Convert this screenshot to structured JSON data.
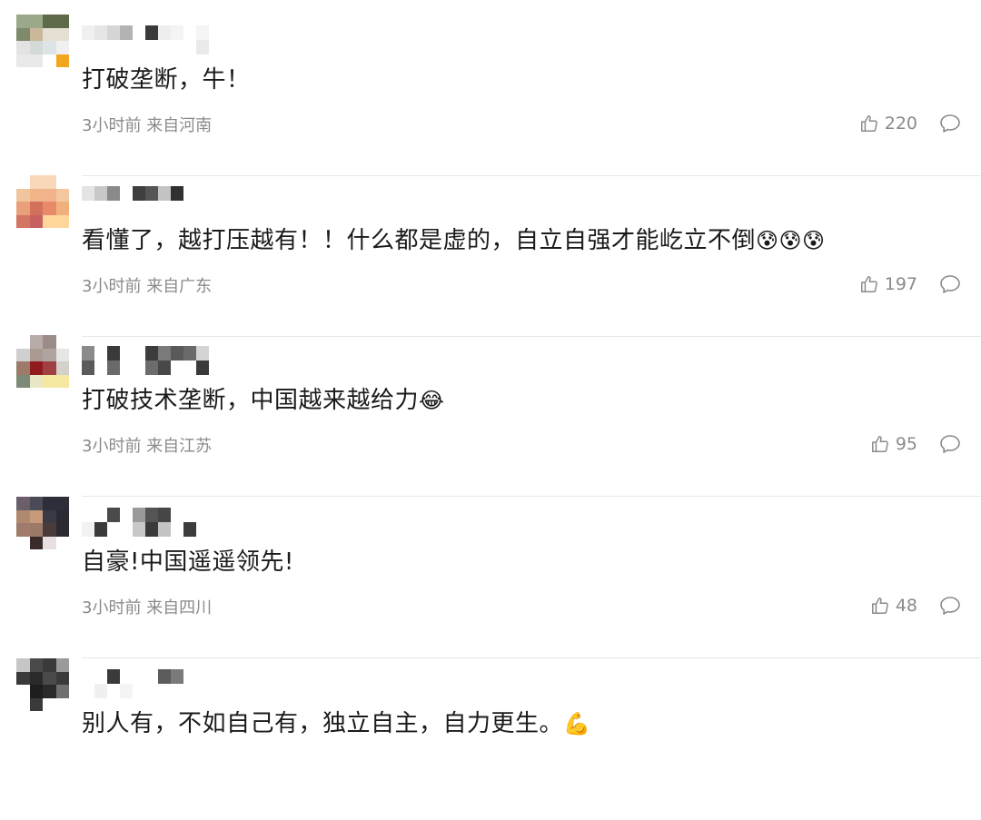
{
  "comments": [
    {
      "text": "打破垄断，牛！",
      "emoji": "",
      "time": "3小时前",
      "location": "来自河南",
      "likes": "220",
      "avatar_colors": [
        "#9ca88a",
        "#9ca88a",
        "#5e6a4a",
        "#5e6a4a",
        "#7d8a6c",
        "#c9b89a",
        "#e6e0d4",
        "#e6e0d4",
        "#e3e3e3",
        "#d4dad8",
        "#dde4e6",
        "#f0f0f0",
        "#e9e9e9",
        "#e9e9e9",
        "#ffffff",
        "#f2a51e"
      ],
      "name_pixels": [
        "#f0f0f0",
        "#ffffff",
        "#e6e6e6",
        "#ffffff",
        "#d6d6d6",
        "#ffffff",
        "#b3b3b3",
        "#ffffff",
        "#ffffff",
        "#ffffff",
        "#3a3a3a",
        "#ffffff",
        "#eeeeee",
        "#ffffff",
        "#f4f4f4",
        "#ffffff",
        "#ffffff",
        "#ffffff",
        "#f5f5f5",
        "#eaeaea"
      ]
    },
    {
      "text": "看懂了，越打压越有！！什么都是虚的，自立自强才能屹立不倒",
      "emoji": "😰😰😰",
      "time": "3小时前",
      "location": "来自广东",
      "likes": "197",
      "avatar_colors": [
        "#ffffff",
        "#f8d8b8",
        "#f8d8b8",
        "#ffffff",
        "#f0c49c",
        "#f3b48a",
        "#f2b28c",
        "#f4c7a0",
        "#e9a07a",
        "#d3705c",
        "#e88a6a",
        "#f0b07c",
        "#d47462",
        "#c86060",
        "#ffd79a",
        "#ffd79a"
      ],
      "name_pixels": [
        "#e4e4e4",
        "#ffffff",
        "#c8c8c8",
        "#ffffff",
        "#8a8a8a",
        "#ffffff",
        "#ffffff",
        "#ffffff",
        "#3f3f3f",
        "#ffffff",
        "#555555",
        "#ffffff",
        "#c4c4c4",
        "#ffffff",
        "#303030",
        "#ffffff"
      ]
    },
    {
      "text": "打破技术垄断，中国越来越给力",
      "emoji": "😂",
      "time": "3小时前",
      "location": "来自江苏",
      "likes": "95",
      "avatar_colors": [
        "#ffffff",
        "#b8aca8",
        "#9c8c88",
        "#ffffff",
        "#cfcfcf",
        "#aa9a92",
        "#b0a4a0",
        "#e6e6e6",
        "#9e7a6a",
        "#901a1e",
        "#a04040",
        "#d4d0ca",
        "#7e8a78",
        "#e8e6c4",
        "#f6e8a0",
        "#f6e8a0"
      ],
      "name_pixels": [
        "#8a8a8a",
        "#5a5a5a",
        "#ffffff",
        "#ffffff",
        "#3a3a3a",
        "#6a6a6a",
        "#ffffff",
        "#ffffff",
        "#ffffff",
        "#ffffff",
        "#3c3c3c",
        "#6c6c6c",
        "#7a7a7a",
        "#484848",
        "#5a5a5a",
        "#ffffff",
        "#6a6a6a",
        "#ffffff",
        "#d4d4d4",
        "#3a3a3a"
      ]
    },
    {
      "text": "自豪!中国遥遥领先!",
      "emoji": "",
      "time": "3小时前",
      "location": "来自四川",
      "likes": "48",
      "avatar_colors": [
        "#6a5e6a",
        "#4a4a58",
        "#2e2e3a",
        "#2e2e3a",
        "#b08a6e",
        "#c89a7a",
        "#3a3a44",
        "#2a2a34",
        "#a07a6a",
        "#9c7a6a",
        "#4a3a3a",
        "#2a2a30",
        "#ffffff",
        "#3a2a2a",
        "#e8e0e0",
        "#ffffff"
      ],
      "name_pixels": [
        "#ffffff",
        "#f2f2f2",
        "#ffffff",
        "#3a3a3a",
        "#4a4a4a",
        "#ffffff",
        "#ffffff",
        "#ffffff",
        "#9a9a9a",
        "#c8c8c8",
        "#555555",
        "#3a3a3a",
        "#464646",
        "#c4c4c4",
        "#ffffff",
        "#ffffff",
        "#ffffff",
        "#3c3c3c"
      ]
    },
    {
      "text": "别人有，不如自己有，独立自主，自力更生。",
      "emoji": "💪",
      "time": "",
      "location": "",
      "likes": "",
      "avatar_colors": [
        "#c6c6c6",
        "#4a4a4a",
        "#3a3a3a",
        "#9a9a9a",
        "#3a3a3a",
        "#2a2a2a",
        "#4a4a4a",
        "#3a3a3a",
        "#ffffff",
        "#1e1e1e",
        "#2a2a2a",
        "#707070",
        "#ffffff",
        "#3a3a3a",
        "#ffffff",
        "#ffffff"
      ],
      "name_pixels": [
        "#ffffff",
        "#ffffff",
        "#ffffff",
        "#f0f0f0",
        "#3a3a3a",
        "#ffffff",
        "#ffffff",
        "#f4f4f4",
        "#ffffff",
        "#ffffff",
        "#ffffff",
        "#ffffff",
        "#5c5c5c",
        "#ffffff",
        "#7a7a7a",
        "#ffffff"
      ]
    }
  ],
  "icons": {
    "like": "thumbs-up-icon",
    "reply": "comment-bubble-icon"
  }
}
